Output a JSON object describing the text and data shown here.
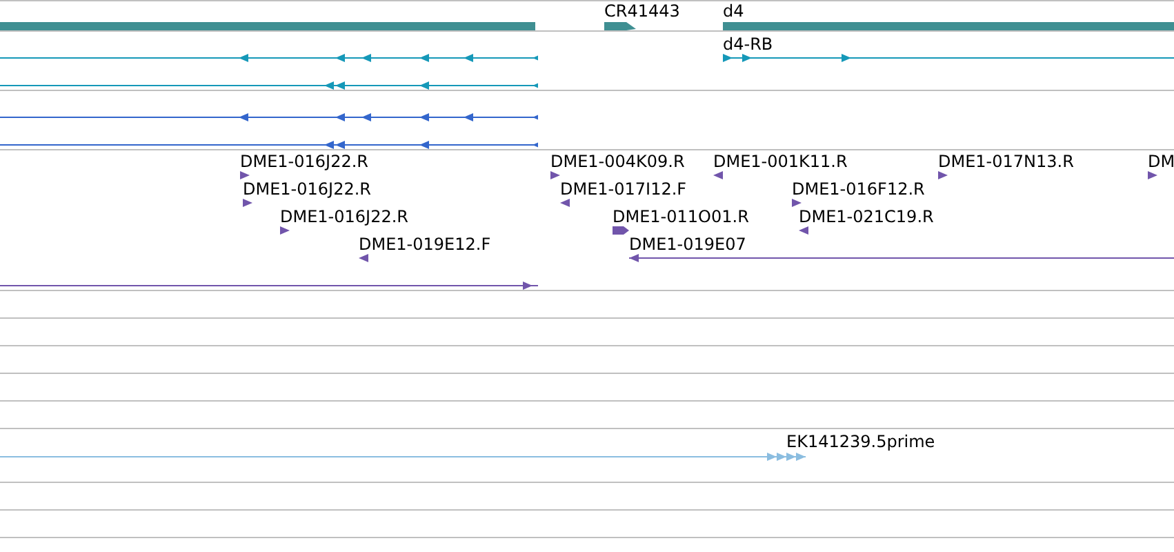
{
  "tracks": [
    {
      "features": [
        {
          "kind": "bar"
        },
        {
          "kind": "bar",
          "label": "CR41443",
          "forward": true
        },
        {
          "kind": "bar",
          "label": "d4"
        }
      ]
    },
    {
      "features": [
        {
          "kind": "line",
          "forward": false
        },
        {
          "kind": "line",
          "forward": false
        },
        {
          "kind": "line",
          "label": "d4-RB",
          "forward": true
        }
      ]
    },
    {
      "features": [
        {
          "kind": "line",
          "forward": false
        },
        {
          "kind": "line",
          "forward": false
        }
      ]
    },
    {
      "features": [
        {
          "kind": "mark",
          "label": "DME1-016J22.R",
          "forward": true
        },
        {
          "kind": "mark",
          "label": "DME1-016J22.R",
          "forward": true
        },
        {
          "kind": "mark",
          "label": "DME1-016J22.R",
          "forward": true
        },
        {
          "kind": "mark",
          "label": "DME1-019E12.F",
          "forward": false
        },
        {
          "kind": "line",
          "forward": true
        },
        {
          "kind": "mark",
          "label": "DME1-004K09.R",
          "forward": true
        },
        {
          "kind": "mark",
          "label": "DME1-017I12.F",
          "forward": false
        },
        {
          "kind": "block",
          "label": "DME1-011O01.R",
          "forward": true
        },
        {
          "kind": "line",
          "label": "DME1-019E07",
          "forward": false
        },
        {
          "kind": "mark",
          "label": "DME1-001K11.R",
          "forward": false
        },
        {
          "kind": "mark",
          "label": "DME1-016F12.R",
          "forward": true
        },
        {
          "kind": "mark",
          "label": "DME1-021C19.R",
          "forward": false
        },
        {
          "kind": "mark",
          "label": "DME1-017N13.R",
          "forward": true
        },
        {
          "kind": "mark",
          "label": "DM",
          "forward": true
        }
      ]
    },
    {
      "features": [
        {
          "kind": "line",
          "label": "EK141239.5prime",
          "forward": true
        }
      ]
    }
  ]
}
